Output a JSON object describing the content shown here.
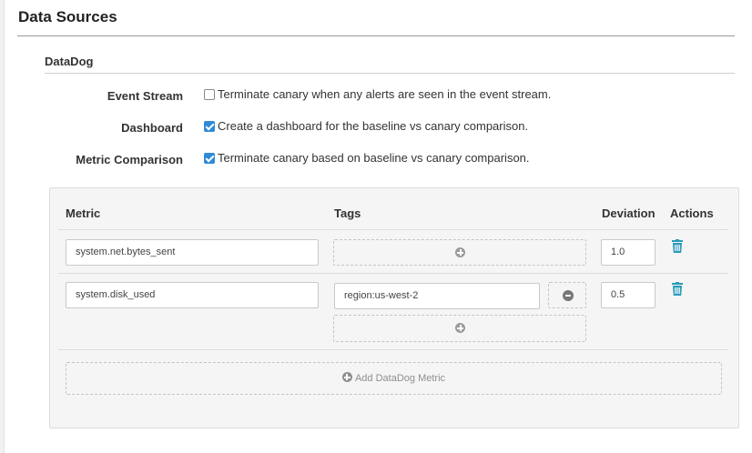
{
  "section": {
    "title": "Data Sources"
  },
  "datadog": {
    "title": "DataDog",
    "options": [
      {
        "label": "Event Stream",
        "checked": false,
        "text": "Terminate canary when any alerts are seen in the event stream."
      },
      {
        "label": "Dashboard",
        "checked": true,
        "text": "Create a dashboard for the baseline vs canary comparison."
      },
      {
        "label": "Metric Comparison",
        "checked": true,
        "text": "Terminate canary based on baseline vs canary comparison."
      }
    ],
    "table": {
      "columns": {
        "metric": "Metric",
        "tags": "Tags",
        "deviation": "Deviation",
        "actions": "Actions"
      },
      "rows": [
        {
          "metric": "system.net.bytes_sent",
          "tags": [],
          "deviation": "1.0"
        },
        {
          "metric": "system.disk_used",
          "tags": [
            "region:us-west-2"
          ],
          "deviation": "0.5"
        }
      ],
      "add_label": "Add DataDog Metric"
    }
  },
  "colors": {
    "accent": "#2f8bd8",
    "trash": "#2a9bb8"
  },
  "icons": {
    "add": "plus-circle-icon",
    "remove": "minus-circle-icon",
    "delete": "trash-icon",
    "checkbox": "checkbox-icon"
  }
}
